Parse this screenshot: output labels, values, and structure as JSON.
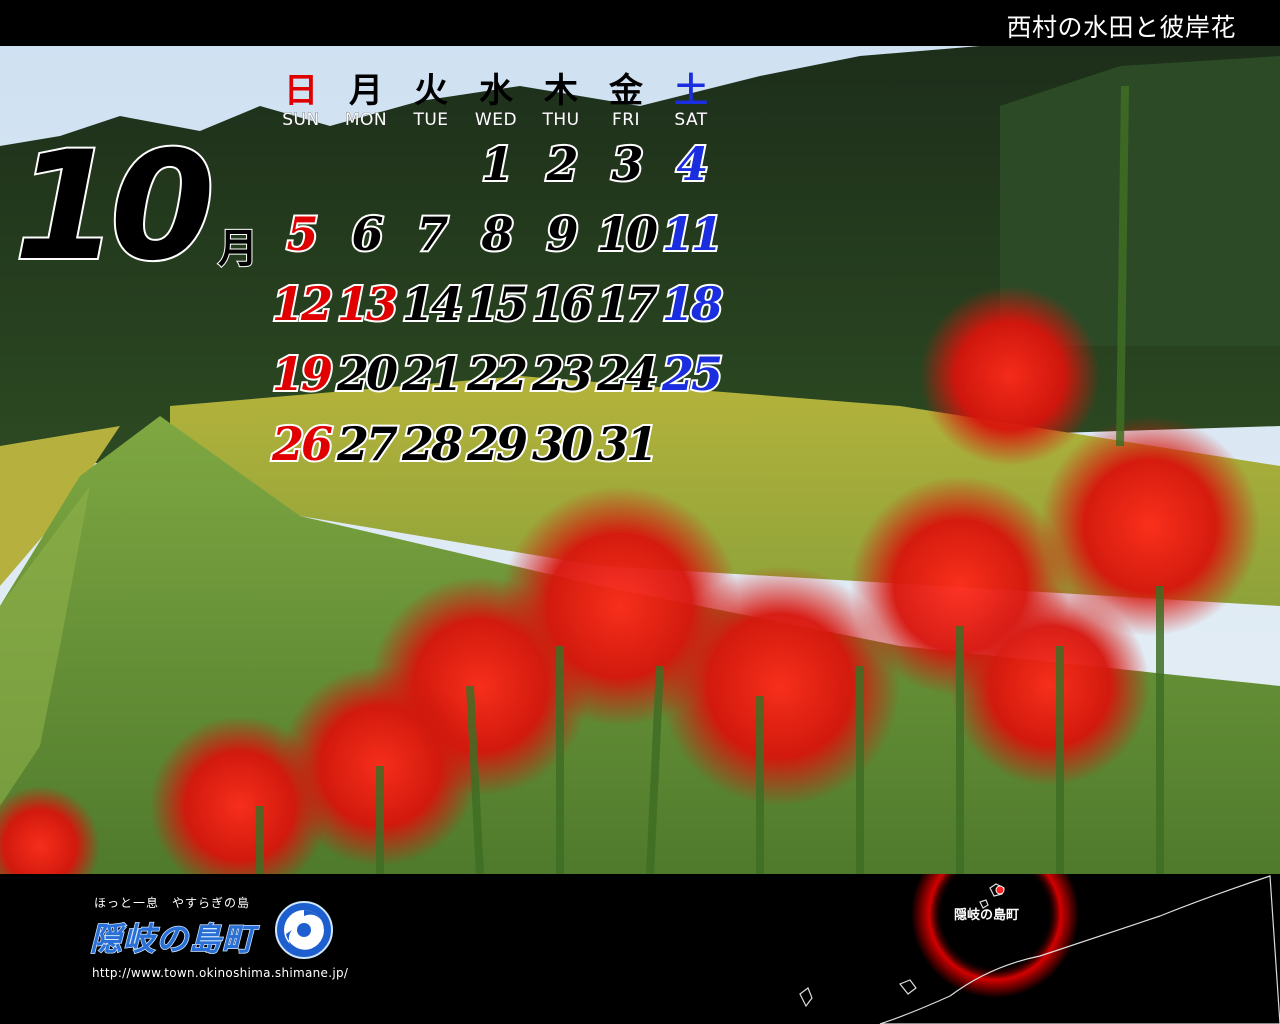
{
  "header": {
    "title": "西村の水田と彼岸花"
  },
  "calendar": {
    "month_number": "10",
    "month_kanji": "月",
    "weekdays": [
      {
        "kanji": "日",
        "en": "SUN",
        "color": "#e10000"
      },
      {
        "kanji": "月",
        "en": "MON",
        "color": "#000000"
      },
      {
        "kanji": "火",
        "en": "TUE",
        "color": "#000000"
      },
      {
        "kanji": "水",
        "en": "WED",
        "color": "#000000"
      },
      {
        "kanji": "木",
        "en": "THU",
        "color": "#000000"
      },
      {
        "kanji": "金",
        "en": "FRI",
        "color": "#000000"
      },
      {
        "kanji": "土",
        "en": "SAT",
        "color": "#1a2ee0"
      }
    ],
    "weeks": [
      [
        null,
        null,
        null,
        "1",
        "2",
        "3",
        "4"
      ],
      [
        "5",
        "6",
        "7",
        "8",
        "9",
        "10",
        "11"
      ],
      [
        "12",
        "13",
        "14",
        "15",
        "16",
        "17",
        "18"
      ],
      [
        "19",
        "20",
        "21",
        "22",
        "23",
        "24",
        "25"
      ],
      [
        "26",
        "27",
        "28",
        "29",
        "30",
        "31",
        null
      ]
    ],
    "holidays": [
      "13"
    ],
    "colors": {
      "weekday": "#000000",
      "sunday": "#e10000",
      "holiday": "#e10000",
      "saturday": "#1a2ee0"
    }
  },
  "footer": {
    "tagline": "ほっと一息　やすらぎの島",
    "logo_text": "隠岐の島町",
    "url": "http://www.town.okinoshima.shimane.jp/",
    "map_label": "隠岐の島町",
    "map_highlight_color": "#e00000"
  }
}
